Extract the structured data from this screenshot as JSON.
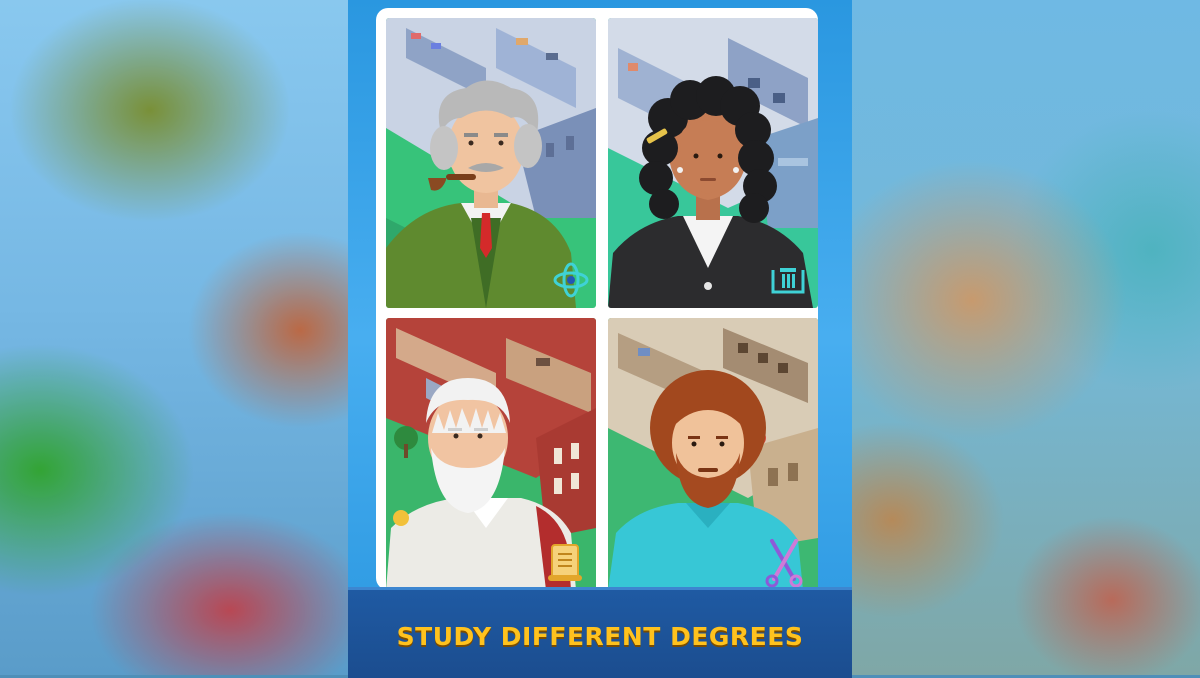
{
  "banner": {
    "title": "STUDY DIFFERENT DEGREES"
  },
  "characters": [
    {
      "id": "scientist",
      "badge_icon": "atom-icon",
      "accent": "#3fd2d6"
    },
    {
      "id": "lawyer",
      "badge_icon": "gavel-column-icon",
      "accent": "#3fd2d6"
    },
    {
      "id": "philosopher",
      "badge_icon": "scroll-icon",
      "accent": "#f2b53a"
    },
    {
      "id": "artist",
      "badge_icon": "scissors-brush-icon",
      "accent": "#8d5ad8"
    }
  ],
  "colors": {
    "panel_blue": "#2a97e0",
    "banner_navy": "#1b4d8f",
    "banner_text": "#ffc21e",
    "card_white": "#ffffff"
  }
}
